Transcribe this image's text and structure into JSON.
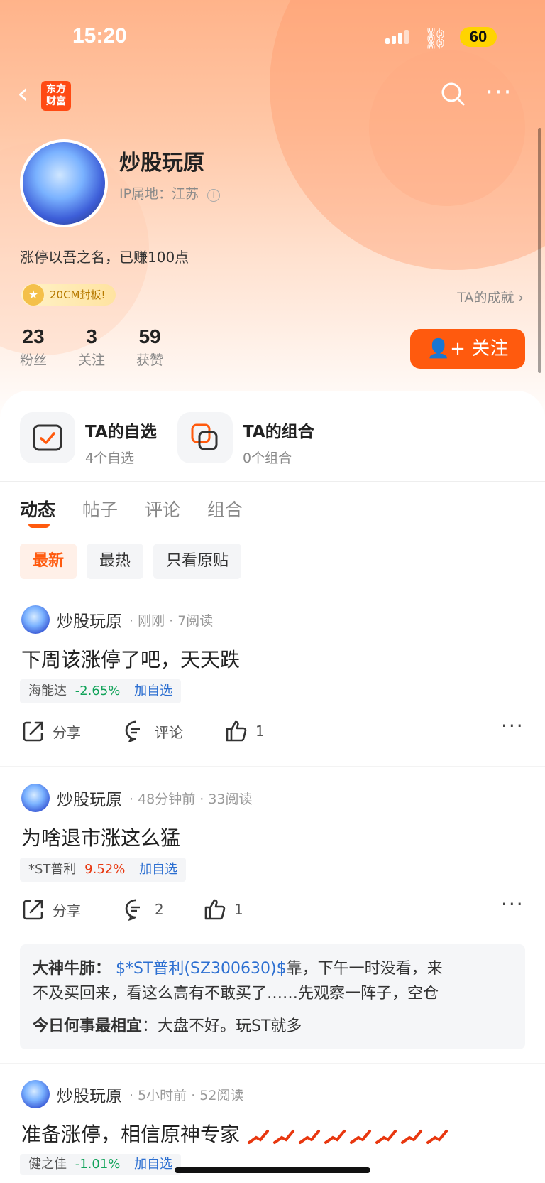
{
  "status_bar": {
    "time": "15:20",
    "battery": "60"
  },
  "nav": {
    "logo_text": "东方\n财富"
  },
  "profile": {
    "name": "炒股玩原",
    "ip_location": "IP属地：江苏",
    "bio": "涨停以吾之名，已赚100点",
    "badge": "20CM封板!",
    "achievements_link": "TA的成就",
    "stats": [
      {
        "value": "23",
        "label": "粉丝"
      },
      {
        "value": "3",
        "label": "关注"
      },
      {
        "value": "59",
        "label": "获赞"
      }
    ],
    "follow_label": "关注"
  },
  "shortcuts": [
    {
      "title": "TA的自选",
      "sub": "4个自选"
    },
    {
      "title": "TA的组合",
      "sub": "0个组合"
    }
  ],
  "tabs": [
    "动态",
    "帖子",
    "评论",
    "组合"
  ],
  "filters": [
    "最新",
    "最热",
    "只看原贴"
  ],
  "posts": [
    {
      "author": "炒股玩原",
      "meta": "· 刚刚 · 7阅读",
      "title": "下周该涨停了吧，天天跌",
      "stock_name": "海能达",
      "stock_change": "-2.65%",
      "add_label": "加自选",
      "share_label": "分享",
      "comment_label": "评论",
      "like_count": "1"
    },
    {
      "author": "炒股玩原",
      "meta": "· 48分钟前 · 33阅读",
      "title": "为啥退市涨这么猛",
      "stock_name": "*ST普利",
      "stock_change": "9.52%",
      "add_label": "加自选",
      "share_label": "分享",
      "comment_count": "2",
      "like_count": "1",
      "comments": [
        {
          "who": "大神牛肺：",
          "tag": "$*ST普利(SZ300630)$",
          "text1": "靠，下午一时没看，来",
          "text2": "不及买回来，看这么高有不敢买了……先观察一阵子，空仓"
        },
        {
          "who": "今日何事最相宜",
          "text": "：大盘不好。玩ST就多"
        }
      ]
    },
    {
      "author": "炒股玩原",
      "meta": "· 5小时前 · 52阅读",
      "title": "准备涨停，相信原神专家",
      "stock_name": "健之佳",
      "stock_change": "-1.01%",
      "add_label": "加自选"
    }
  ]
}
